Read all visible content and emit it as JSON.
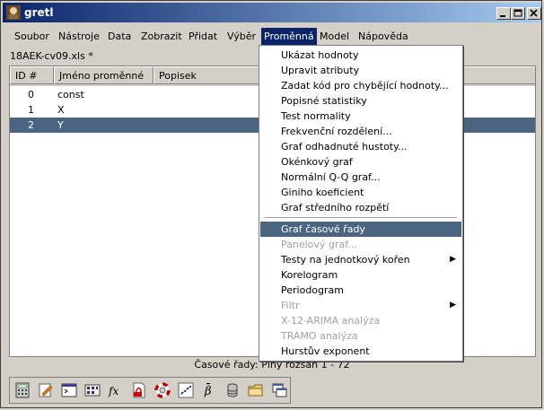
{
  "window": {
    "title": "gretl"
  },
  "menubar": [
    "Soubor",
    "Nástroje",
    "Data",
    "Zobrazit",
    "Přidat",
    "Výběr",
    "Proměnná",
    "Model",
    "Nápověda"
  ],
  "file_label": "18AEK-cv09.xls *",
  "table": {
    "headers": [
      "ID #",
      "Jméno proměnné",
      "Popisek"
    ],
    "rows": [
      {
        "id": "0",
        "name": "const"
      },
      {
        "id": "1",
        "name": "X"
      },
      {
        "id": "2",
        "name": "Y"
      }
    ]
  },
  "variable_menu": {
    "group1": [
      "Ukázat hodnoty",
      "Upravit atributy",
      "Zadat kód pro chybějící hodnoty...",
      "Popisné statistiky",
      "Test normality",
      "Frekvenční rozdělení...",
      "Graf odhadnuté hustoty...",
      "Okénkový graf",
      "Normální Q-Q graf...",
      "Giniho koeficient",
      "Graf středního rozpětí"
    ],
    "group2": [
      "Graf časové řady",
      "Panelový graf...",
      "Testy na jednotkový kořen",
      "Korelogram",
      "Periodogram",
      "Filtr",
      "X-12-ARIMA analýza",
      "TRAMO analýza",
      "Hurstův exponent"
    ]
  },
  "status": "Časové řady: Plný rozsah 1 - 72",
  "toolbar_icons": [
    "calculator-icon",
    "edit-script-icon",
    "console-icon",
    "session-icons-icon",
    "function-icon",
    "pdf-help-icon",
    "lifebuoy-help-icon",
    "scatter-plot-icon",
    "beta-model-icon",
    "database-icon",
    "folder-icon",
    "windows-icon"
  ]
}
